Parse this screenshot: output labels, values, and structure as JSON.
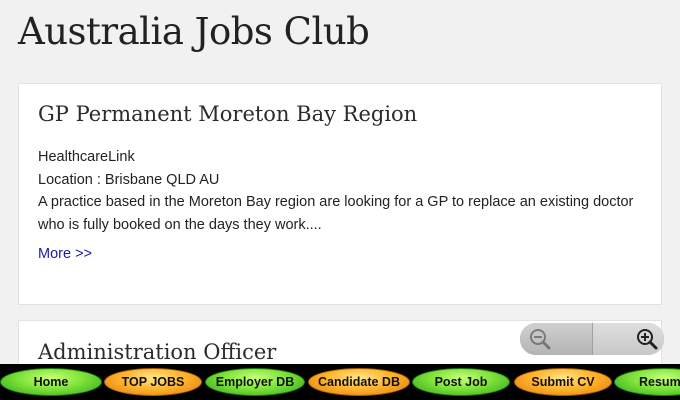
{
  "site": {
    "title": "Australia Jobs Club"
  },
  "jobs": [
    {
      "title": "GP Permanent Moreton Bay Region",
      "company": "HealthcareLink",
      "location": "Location : Brisbane QLD AU",
      "description": "A practice based in the Moreton Bay region are looking for a GP to replace an existing doctor who is fully booked on the days they work....",
      "more_label": "More >>"
    },
    {
      "title": "Administration Officer"
    }
  ],
  "zoom": {
    "out_icon": "zoom-out-icon",
    "in_icon": "zoom-in-icon"
  },
  "nav": {
    "items": [
      {
        "label": "Home",
        "color": "green"
      },
      {
        "label": "TOP JOBS",
        "color": "orange"
      },
      {
        "label": "Employer DB",
        "color": "green"
      },
      {
        "label": "Candidate DB",
        "color": "orange"
      },
      {
        "label": "Post  Job",
        "color": "green"
      },
      {
        "label": "Submit CV",
        "color": "orange"
      },
      {
        "label": "Resum",
        "color": "green"
      }
    ]
  },
  "colors": {
    "background": "#f1f1f1",
    "link": "#1a1aa6",
    "nav_green": "#7fe33a",
    "nav_orange": "#ffb52e"
  }
}
